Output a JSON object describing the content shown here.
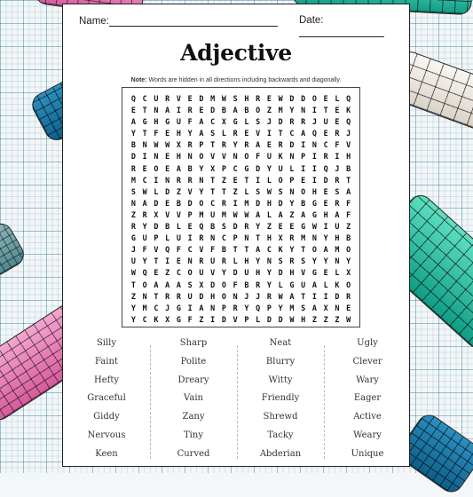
{
  "worksheet": {
    "name_label": "Name:",
    "date_label": "Date:",
    "title": "Adjective",
    "note_label": "Note:",
    "note_text": " Words are hidden in all directions including backwards and diagonally."
  },
  "grid": [
    [
      "Q",
      "C",
      "U",
      "R",
      "V",
      "E",
      "D",
      "M",
      "W",
      "S",
      "H",
      "R",
      "E",
      "W",
      "D",
      "D",
      "O",
      "E",
      "L",
      "Q"
    ],
    [
      "E",
      "T",
      "N",
      "A",
      "I",
      "R",
      "E",
      "D",
      "B",
      "A",
      "B",
      "O",
      "Z",
      "M",
      "Y",
      "N",
      "I",
      "T",
      "E",
      "K"
    ],
    [
      "A",
      "G",
      "H",
      "G",
      "U",
      "F",
      "A",
      "C",
      "X",
      "G",
      "L",
      "S",
      "J",
      "D",
      "R",
      "R",
      "J",
      "U",
      "E",
      "Q"
    ],
    [
      "Y",
      "T",
      "F",
      "E",
      "H",
      "Y",
      "A",
      "S",
      "L",
      "R",
      "E",
      "V",
      "I",
      "T",
      "C",
      "A",
      "Q",
      "E",
      "R",
      "J"
    ],
    [
      "B",
      "N",
      "W",
      "W",
      "X",
      "R",
      "P",
      "T",
      "R",
      "Y",
      "R",
      "A",
      "E",
      "R",
      "D",
      "I",
      "N",
      "C",
      "F",
      "V"
    ],
    [
      "D",
      "I",
      "N",
      "E",
      "H",
      "N",
      "O",
      "V",
      "V",
      "N",
      "O",
      "F",
      "U",
      "K",
      "N",
      "P",
      "I",
      "R",
      "I",
      "H"
    ],
    [
      "R",
      "E",
      "O",
      "E",
      "A",
      "B",
      "Y",
      "X",
      "P",
      "C",
      "G",
      "D",
      "Y",
      "U",
      "L",
      "I",
      "I",
      "Q",
      "J",
      "B"
    ],
    [
      "M",
      "C",
      "I",
      "N",
      "R",
      "R",
      "N",
      "T",
      "Z",
      "E",
      "T",
      "I",
      "L",
      "O",
      "P",
      "E",
      "I",
      "D",
      "R",
      "T"
    ],
    [
      "S",
      "W",
      "L",
      "D",
      "Z",
      "V",
      "Y",
      "T",
      "T",
      "Z",
      "L",
      "S",
      "W",
      "S",
      "N",
      "O",
      "H",
      "E",
      "S",
      "A"
    ],
    [
      "N",
      "A",
      "D",
      "E",
      "B",
      "D",
      "O",
      "C",
      "R",
      "I",
      "M",
      "D",
      "H",
      "D",
      "Y",
      "B",
      "G",
      "E",
      "R",
      "F"
    ],
    [
      "Z",
      "R",
      "X",
      "V",
      "V",
      "P",
      "M",
      "U",
      "M",
      "W",
      "W",
      "A",
      "L",
      "A",
      "Z",
      "A",
      "G",
      "H",
      "A",
      "F"
    ],
    [
      "R",
      "Y",
      "D",
      "B",
      "L",
      "E",
      "Q",
      "B",
      "S",
      "D",
      "R",
      "Y",
      "Z",
      "E",
      "E",
      "G",
      "W",
      "I",
      "U",
      "Z"
    ],
    [
      "G",
      "U",
      "P",
      "L",
      "U",
      "I",
      "R",
      "N",
      "C",
      "P",
      "N",
      "T",
      "H",
      "X",
      "R",
      "M",
      "N",
      "Y",
      "H",
      "B"
    ],
    [
      "J",
      "F",
      "V",
      "Q",
      "F",
      "C",
      "V",
      "F",
      "B",
      "T",
      "T",
      "A",
      "C",
      "K",
      "Y",
      "T",
      "O",
      "A",
      "M",
      "O"
    ],
    [
      "U",
      "Y",
      "T",
      "I",
      "E",
      "N",
      "R",
      "U",
      "R",
      "L",
      "H",
      "Y",
      "N",
      "S",
      "R",
      "S",
      "Y",
      "Y",
      "N",
      "Y"
    ],
    [
      "W",
      "Q",
      "E",
      "Z",
      "C",
      "O",
      "U",
      "V",
      "Y",
      "D",
      "U",
      "H",
      "Y",
      "D",
      "H",
      "V",
      "G",
      "E",
      "L",
      "X"
    ],
    [
      "T",
      "O",
      "A",
      "A",
      "A",
      "S",
      "X",
      "D",
      "O",
      "F",
      "B",
      "R",
      "Y",
      "L",
      "G",
      "U",
      "A",
      "L",
      "K",
      "O"
    ],
    [
      "Z",
      "N",
      "T",
      "R",
      "R",
      "U",
      "D",
      "H",
      "O",
      "N",
      "J",
      "J",
      "R",
      "W",
      "A",
      "T",
      "I",
      "I",
      "D",
      "R"
    ],
    [
      "Y",
      "M",
      "C",
      "J",
      "G",
      "I",
      "A",
      "N",
      "P",
      "R",
      "Y",
      "Q",
      "P",
      "Y",
      "M",
      "S",
      "A",
      "X",
      "N",
      "E"
    ],
    [
      "Y",
      "C",
      "K",
      "X",
      "G",
      "F",
      "Z",
      "I",
      "D",
      "V",
      "P",
      "L",
      "D",
      "D",
      "W",
      "H",
      "Z",
      "Z",
      "Z",
      "W"
    ]
  ],
  "word_columns": [
    [
      "Silly",
      "Faint",
      "Hefty",
      "Graceful",
      "Giddy",
      "Nervous",
      "Keen"
    ],
    [
      "Sharp",
      "Polite",
      "Dreary",
      "Vain",
      "Zany",
      "Tiny",
      "Curved"
    ],
    [
      "Neat",
      "Blurry",
      "Witty",
      "Friendly",
      "Shrewd",
      "Tacky",
      "Abderian"
    ],
    [
      "Ugly",
      "Clever",
      "Wary",
      "Eager",
      "Active",
      "Weary",
      "Unique"
    ]
  ]
}
